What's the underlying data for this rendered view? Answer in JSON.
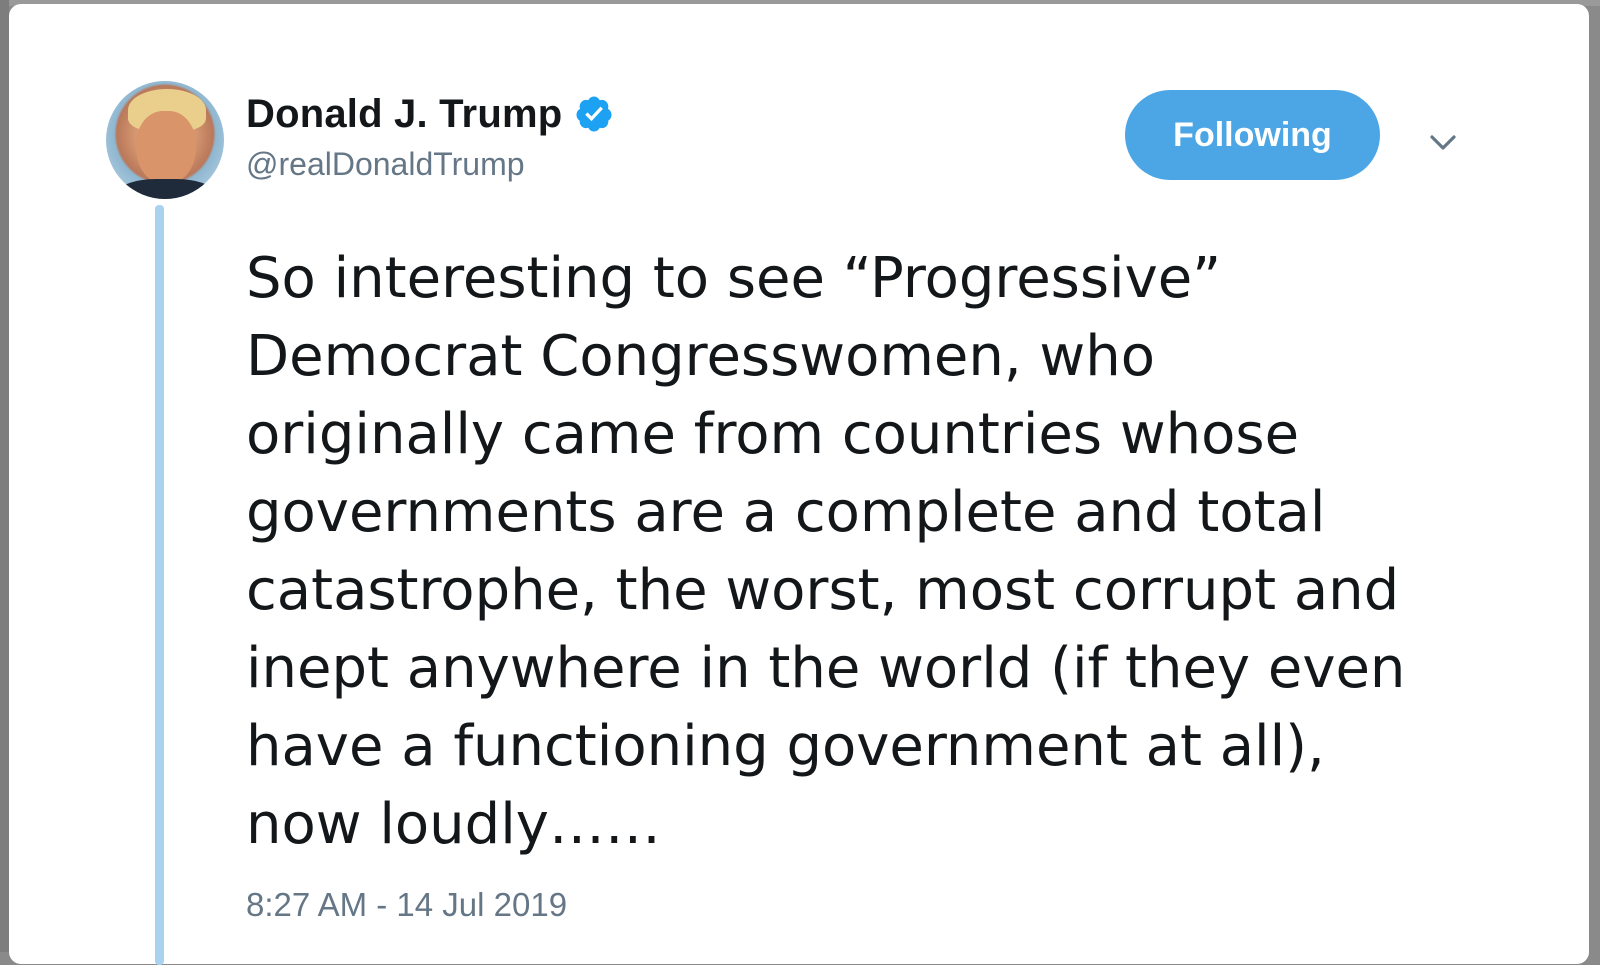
{
  "tweet": {
    "author": {
      "display_name": "Donald J. Trump",
      "handle": "@realDonaldTrump",
      "verified": true,
      "verified_icon": "verified-badge-icon",
      "avatar": "profile-photo"
    },
    "follow_button_label": "Following",
    "menu_icon": "chevron-down-icon",
    "text_lines": [
      "So interesting to see “Progressive”",
      "Democrat Congresswomen, who",
      "originally came from countries whose",
      "governments are a complete and total",
      "catastrophe, the worst, most corrupt and",
      "inept anywhere in the world (if they even",
      "have a functioning government at all),",
      "now loudly……"
    ],
    "timestamp": "8:27 AM - 14 Jul 2019"
  },
  "colors": {
    "accent": "#4ca6e6",
    "thread_line": "#a9d2f0",
    "text": "#14171a",
    "secondary_text": "#657786"
  }
}
